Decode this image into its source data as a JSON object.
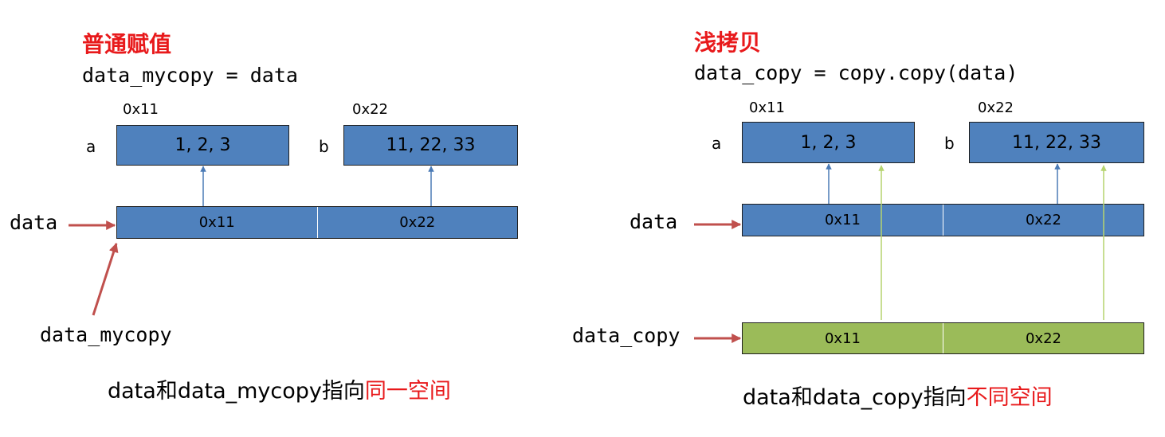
{
  "left": {
    "title": "普通赋值",
    "code": "data_mycopy = data",
    "a_addr": "0x11",
    "b_addr": "0x22",
    "a_label": "a",
    "b_label": "b",
    "a_values": "1, 2, 3",
    "b_values": "11, 22, 33",
    "data_label": "data",
    "data_cells": [
      "0x11",
      "0x22"
    ],
    "copy_label": "data_mycopy",
    "caption_prefix": "data和data_mycopy指向",
    "caption_highlight": "同一空间"
  },
  "right": {
    "title": "浅拷贝",
    "code": "data_copy = copy.copy(data)",
    "a_addr": "0x11",
    "b_addr": "0x22",
    "a_label": "a",
    "b_label": "b",
    "a_values": "1, 2, 3",
    "b_values": "11, 22, 33",
    "data_label": "data",
    "data_cells": [
      "0x11",
      "0x22"
    ],
    "copy_label": "data_copy",
    "copy_cells": [
      "0x11",
      "0x22"
    ],
    "caption_prefix": "data和data_copy指向",
    "caption_highlight": "不同空间"
  },
  "colors": {
    "title_red": "#e8191b",
    "box_blue": "#4f81bd",
    "copy_green": "#9bbb59",
    "pointer_blue_arrow": "#4a7ab5",
    "pointer_green_arrow": "#b5d46f",
    "red_arrow": "#c0504d"
  }
}
